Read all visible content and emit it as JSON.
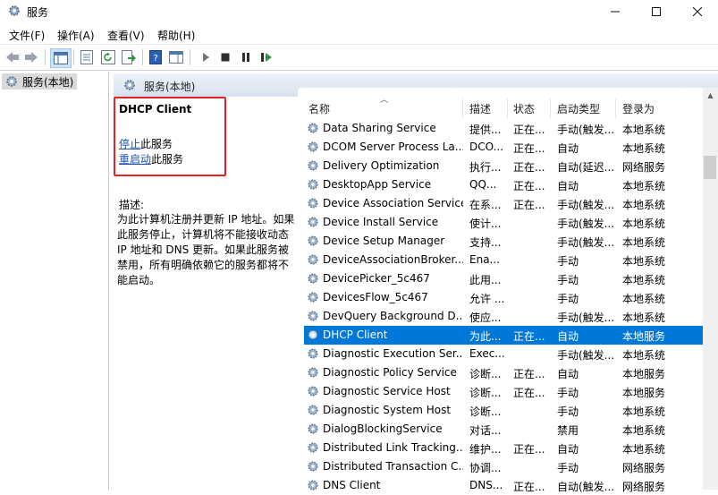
{
  "window": {
    "title": "服务"
  },
  "menu": [
    "文件(F)",
    "操作(A)",
    "查看(V)",
    "帮助(H)"
  ],
  "tree": {
    "node_label": "服务(本地)"
  },
  "pane": {
    "header": "服务(本地)"
  },
  "detail": {
    "service_name": "DHCP Client",
    "stop_link": "停止",
    "stop_suffix": "此服务",
    "restart_link": "重启动",
    "restart_suffix": "此服务",
    "desc_label": "描述:",
    "desc_text": "为此计算机注册并更新 IP 地址。如果此服务停止，计算机将不能接收动态 IP 地址和 DNS 更新。如果此服务被禁用，所有明确依赖它的服务都将不能启动。"
  },
  "columns": [
    "名称",
    "描述",
    "状态",
    "启动类型",
    "登录为"
  ],
  "rows": [
    {
      "name": "Data Sharing Service",
      "desc": "提供...",
      "status": "正在...",
      "startup": "手动(触发...",
      "logon": "本地系统"
    },
    {
      "name": "DCOM Server Process La...",
      "desc": "DCO...",
      "status": "正在...",
      "startup": "自动",
      "logon": "本地系统"
    },
    {
      "name": "Delivery Optimization",
      "desc": "执行...",
      "status": "正在...",
      "startup": "自动(延迟...",
      "logon": "网络服务"
    },
    {
      "name": "DesktopApp Service",
      "desc": "QQ...",
      "status": "正在...",
      "startup": "自动",
      "logon": "本地系统"
    },
    {
      "name": "Device Association Service",
      "desc": "在系...",
      "status": "正在...",
      "startup": "手动(触发...",
      "logon": "本地系统"
    },
    {
      "name": "Device Install Service",
      "desc": "使计...",
      "status": "",
      "startup": "手动(触发...",
      "logon": "本地系统"
    },
    {
      "name": "Device Setup Manager",
      "desc": "支持...",
      "status": "",
      "startup": "手动(触发...",
      "logon": "本地系统"
    },
    {
      "name": "DeviceAssociationBroker...",
      "desc": "Ena...",
      "status": "",
      "startup": "手动",
      "logon": "本地系统"
    },
    {
      "name": "DevicePicker_5c467",
      "desc": "此用...",
      "status": "",
      "startup": "手动",
      "logon": "本地系统"
    },
    {
      "name": "DevicesFlow_5c467",
      "desc": "允许 ...",
      "status": "",
      "startup": "手动",
      "logon": "本地系统"
    },
    {
      "name": "DevQuery Background D...",
      "desc": "使应...",
      "status": "",
      "startup": "手动(触发...",
      "logon": "本地系统"
    },
    {
      "name": "DHCP Client",
      "desc": "为此...",
      "status": "正在...",
      "startup": "自动",
      "logon": "本地服务",
      "selected": true
    },
    {
      "name": "Diagnostic Execution Ser...",
      "desc": "Exec...",
      "status": "",
      "startup": "手动(触发...",
      "logon": "本地系统"
    },
    {
      "name": "Diagnostic Policy Service",
      "desc": "诊断...",
      "status": "正在...",
      "startup": "自动",
      "logon": "本地服务"
    },
    {
      "name": "Diagnostic Service Host",
      "desc": "诊断...",
      "status": "正在...",
      "startup": "手动",
      "logon": "本地服务"
    },
    {
      "name": "Diagnostic System Host",
      "desc": "诊断...",
      "status": "",
      "startup": "手动",
      "logon": "本地系统"
    },
    {
      "name": "DialogBlockingService",
      "desc": "对话...",
      "status": "",
      "startup": "禁用",
      "logon": "本地系统"
    },
    {
      "name": "Distributed Link Tracking...",
      "desc": "维护...",
      "status": "正在...",
      "startup": "自动",
      "logon": "本地系统"
    },
    {
      "name": "Distributed Transaction C...",
      "desc": "协调...",
      "status": "",
      "startup": "手动",
      "logon": "网络服务"
    },
    {
      "name": "DNS Client",
      "desc": "DNS...",
      "status": "正在...",
      "startup": "自动(触发...",
      "logon": "网络服务"
    }
  ],
  "colors": {
    "selection": "#0078d7",
    "link": "#1a55b8",
    "highlight_box": "#e02424"
  }
}
